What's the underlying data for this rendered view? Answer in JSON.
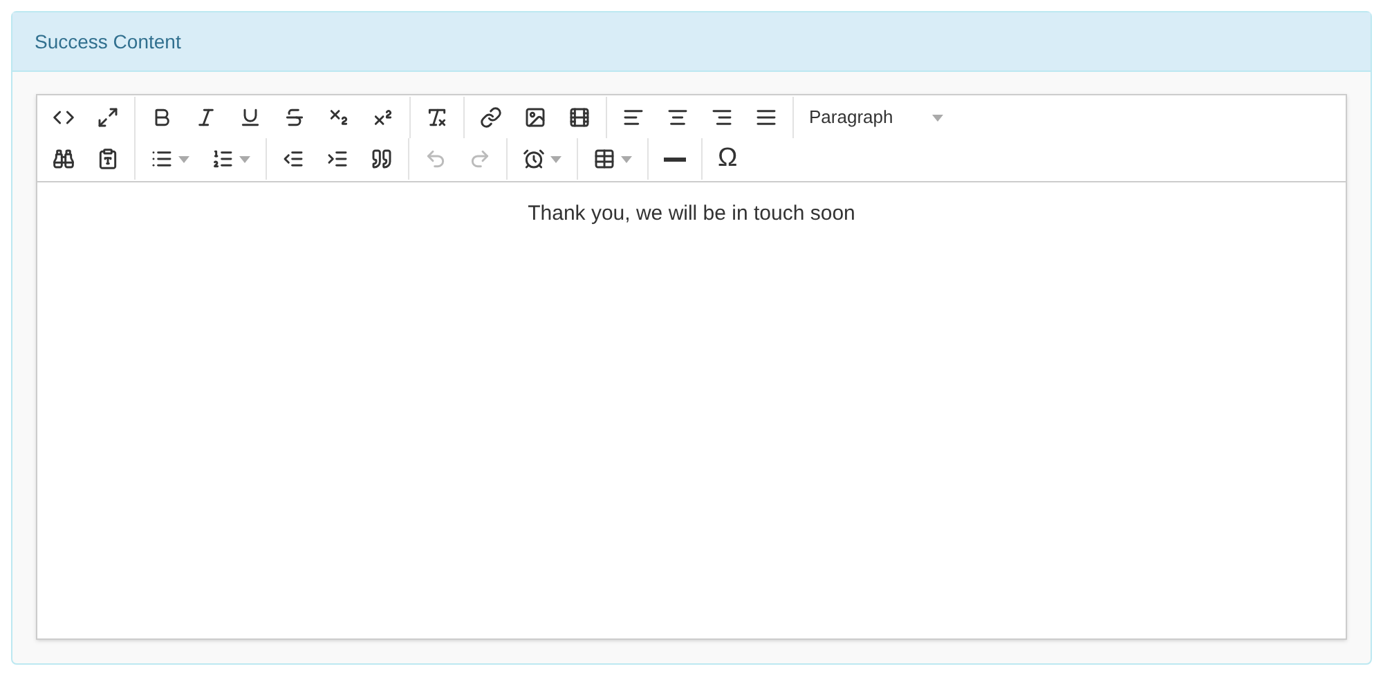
{
  "panel": {
    "title": "Success Content"
  },
  "toolbar": {
    "rows": [
      [
        [
          {
            "kind": "code",
            "disabled": false
          },
          {
            "kind": "fullscreen",
            "disabled": false
          }
        ],
        [
          {
            "kind": "bold",
            "disabled": false
          },
          {
            "kind": "italic",
            "disabled": false
          },
          {
            "kind": "underline",
            "disabled": false
          },
          {
            "kind": "strikethrough",
            "disabled": false
          },
          {
            "kind": "subscript",
            "disabled": false
          },
          {
            "kind": "superscript",
            "disabled": false
          }
        ],
        [
          {
            "kind": "clear-format",
            "disabled": false
          }
        ],
        [
          {
            "kind": "link",
            "disabled": false
          },
          {
            "kind": "image",
            "disabled": false
          },
          {
            "kind": "video",
            "disabled": false
          }
        ],
        [
          {
            "kind": "align-left",
            "disabled": false
          },
          {
            "kind": "align-center",
            "disabled": false
          },
          {
            "kind": "align-right",
            "disabled": false
          },
          {
            "kind": "align-justify",
            "disabled": false
          }
        ],
        [
          {
            "kind": "select",
            "label": "Paragraph",
            "disabled": false
          }
        ]
      ],
      [
        [
          {
            "kind": "find",
            "disabled": false
          },
          {
            "kind": "paste-text",
            "disabled": false
          }
        ],
        [
          {
            "kind": "bullet-list",
            "dropdown": true,
            "disabled": false
          },
          {
            "kind": "numbered-list",
            "dropdown": true,
            "disabled": false
          }
        ],
        [
          {
            "kind": "outdent",
            "disabled": false
          },
          {
            "kind": "indent",
            "disabled": false
          },
          {
            "kind": "quote",
            "disabled": false
          }
        ],
        [
          {
            "kind": "undo",
            "disabled": true
          },
          {
            "kind": "redo",
            "disabled": true
          }
        ],
        [
          {
            "kind": "datetime",
            "dropdown": true,
            "disabled": false
          }
        ],
        [
          {
            "kind": "table",
            "dropdown": true,
            "disabled": false
          }
        ],
        [
          {
            "kind": "hr",
            "disabled": false
          }
        ],
        [
          {
            "kind": "char",
            "label": "Ω",
            "disabled": false
          }
        ]
      ]
    ]
  },
  "content": {
    "text": "Thank you, we will be in touch soon"
  }
}
